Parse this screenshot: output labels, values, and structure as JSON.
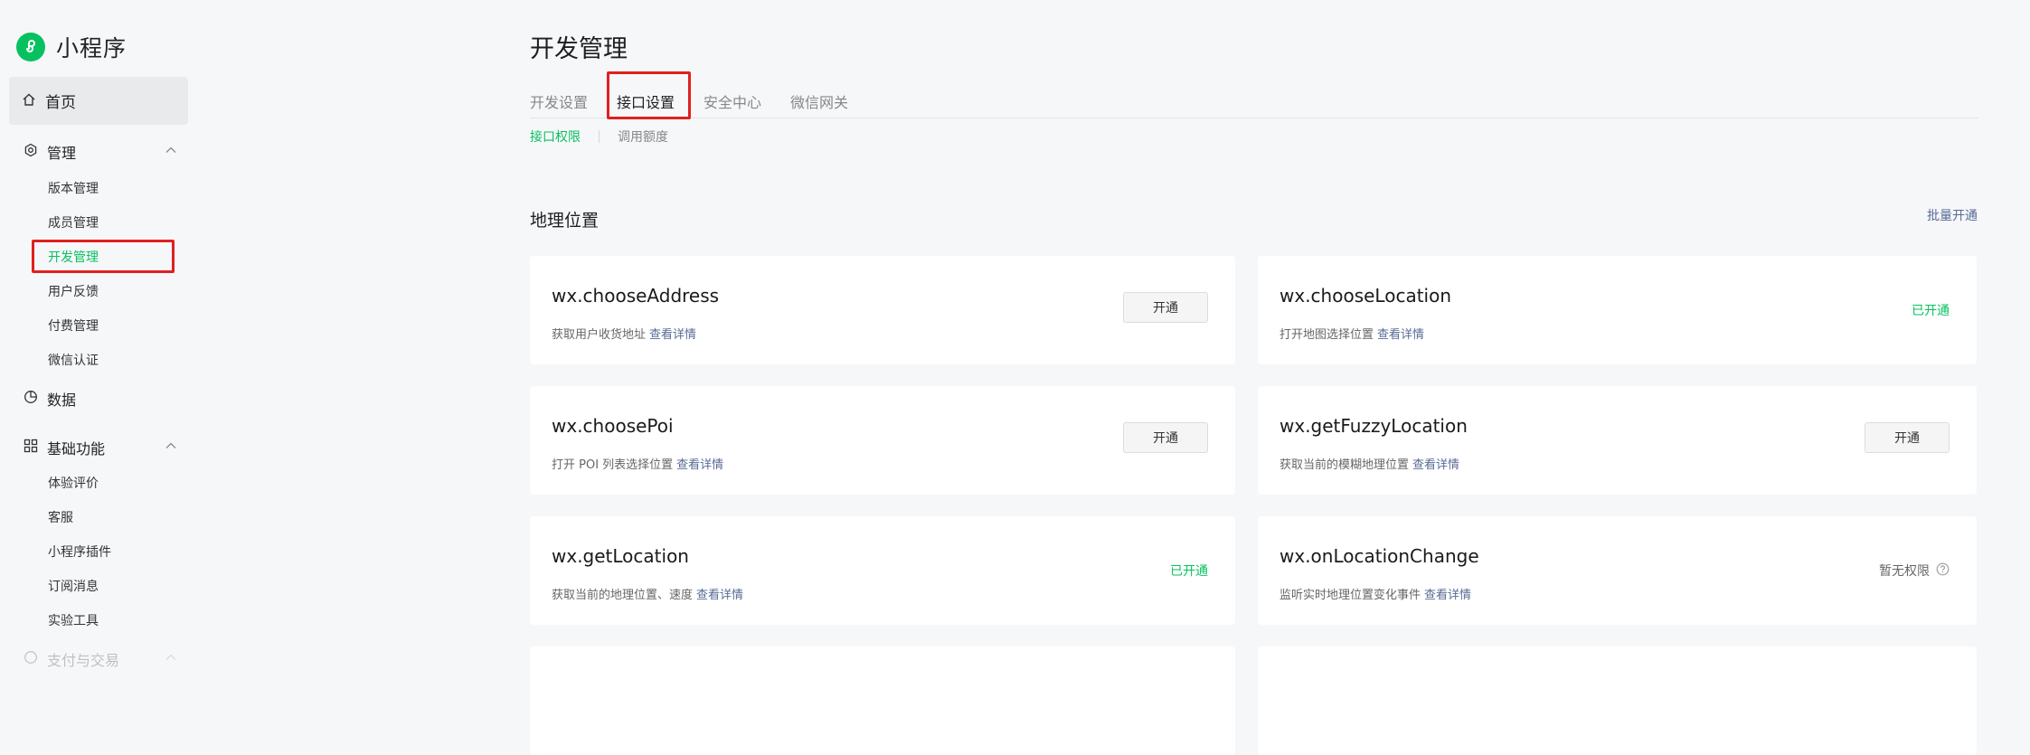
{
  "app": {
    "name": "小程序"
  },
  "sidebar": {
    "home": "首页",
    "groups": [
      {
        "label": "管理",
        "items": [
          "版本管理",
          "成员管理",
          "开发管理",
          "用户反馈",
          "付费管理",
          "微信认证"
        ]
      },
      {
        "label": "数据"
      },
      {
        "label": "基础功能",
        "items": [
          "体验评价",
          "客服",
          "小程序插件",
          "订阅消息",
          "实验工具"
        ]
      },
      {
        "label": "支付与交易"
      }
    ],
    "active_item": "开发管理"
  },
  "main": {
    "title": "开发管理",
    "tabs": [
      "开发设置",
      "接口设置",
      "安全中心",
      "微信网关"
    ],
    "active_tab": "接口设置",
    "subtabs": [
      "接口权限",
      "调用额度"
    ],
    "section": {
      "title": "地理位置",
      "batch_label": "批量开通"
    },
    "detail_link": "查看详情",
    "cards": [
      {
        "name": "wx.chooseAddress",
        "desc": "获取用户收货地址",
        "action": "开通"
      },
      {
        "name": "wx.chooseLocation",
        "desc": "打开地图选择位置",
        "status": "已开通"
      },
      {
        "name": "wx.choosePoi",
        "desc": "打开 POI 列表选择位置",
        "action": "开通"
      },
      {
        "name": "wx.getFuzzyLocation",
        "desc": "获取当前的模糊地理位置",
        "action": "开通"
      },
      {
        "name": "wx.getLocation",
        "desc": "获取当前的地理位置、速度",
        "status": "已开通"
      },
      {
        "name": "wx.onLocationChange",
        "desc": "监听实时地理位置变化事件",
        "status": "暂无权限"
      }
    ]
  },
  "colors": {
    "accent": "#07c160",
    "link": "#576b95",
    "highlight": "#e02020"
  }
}
